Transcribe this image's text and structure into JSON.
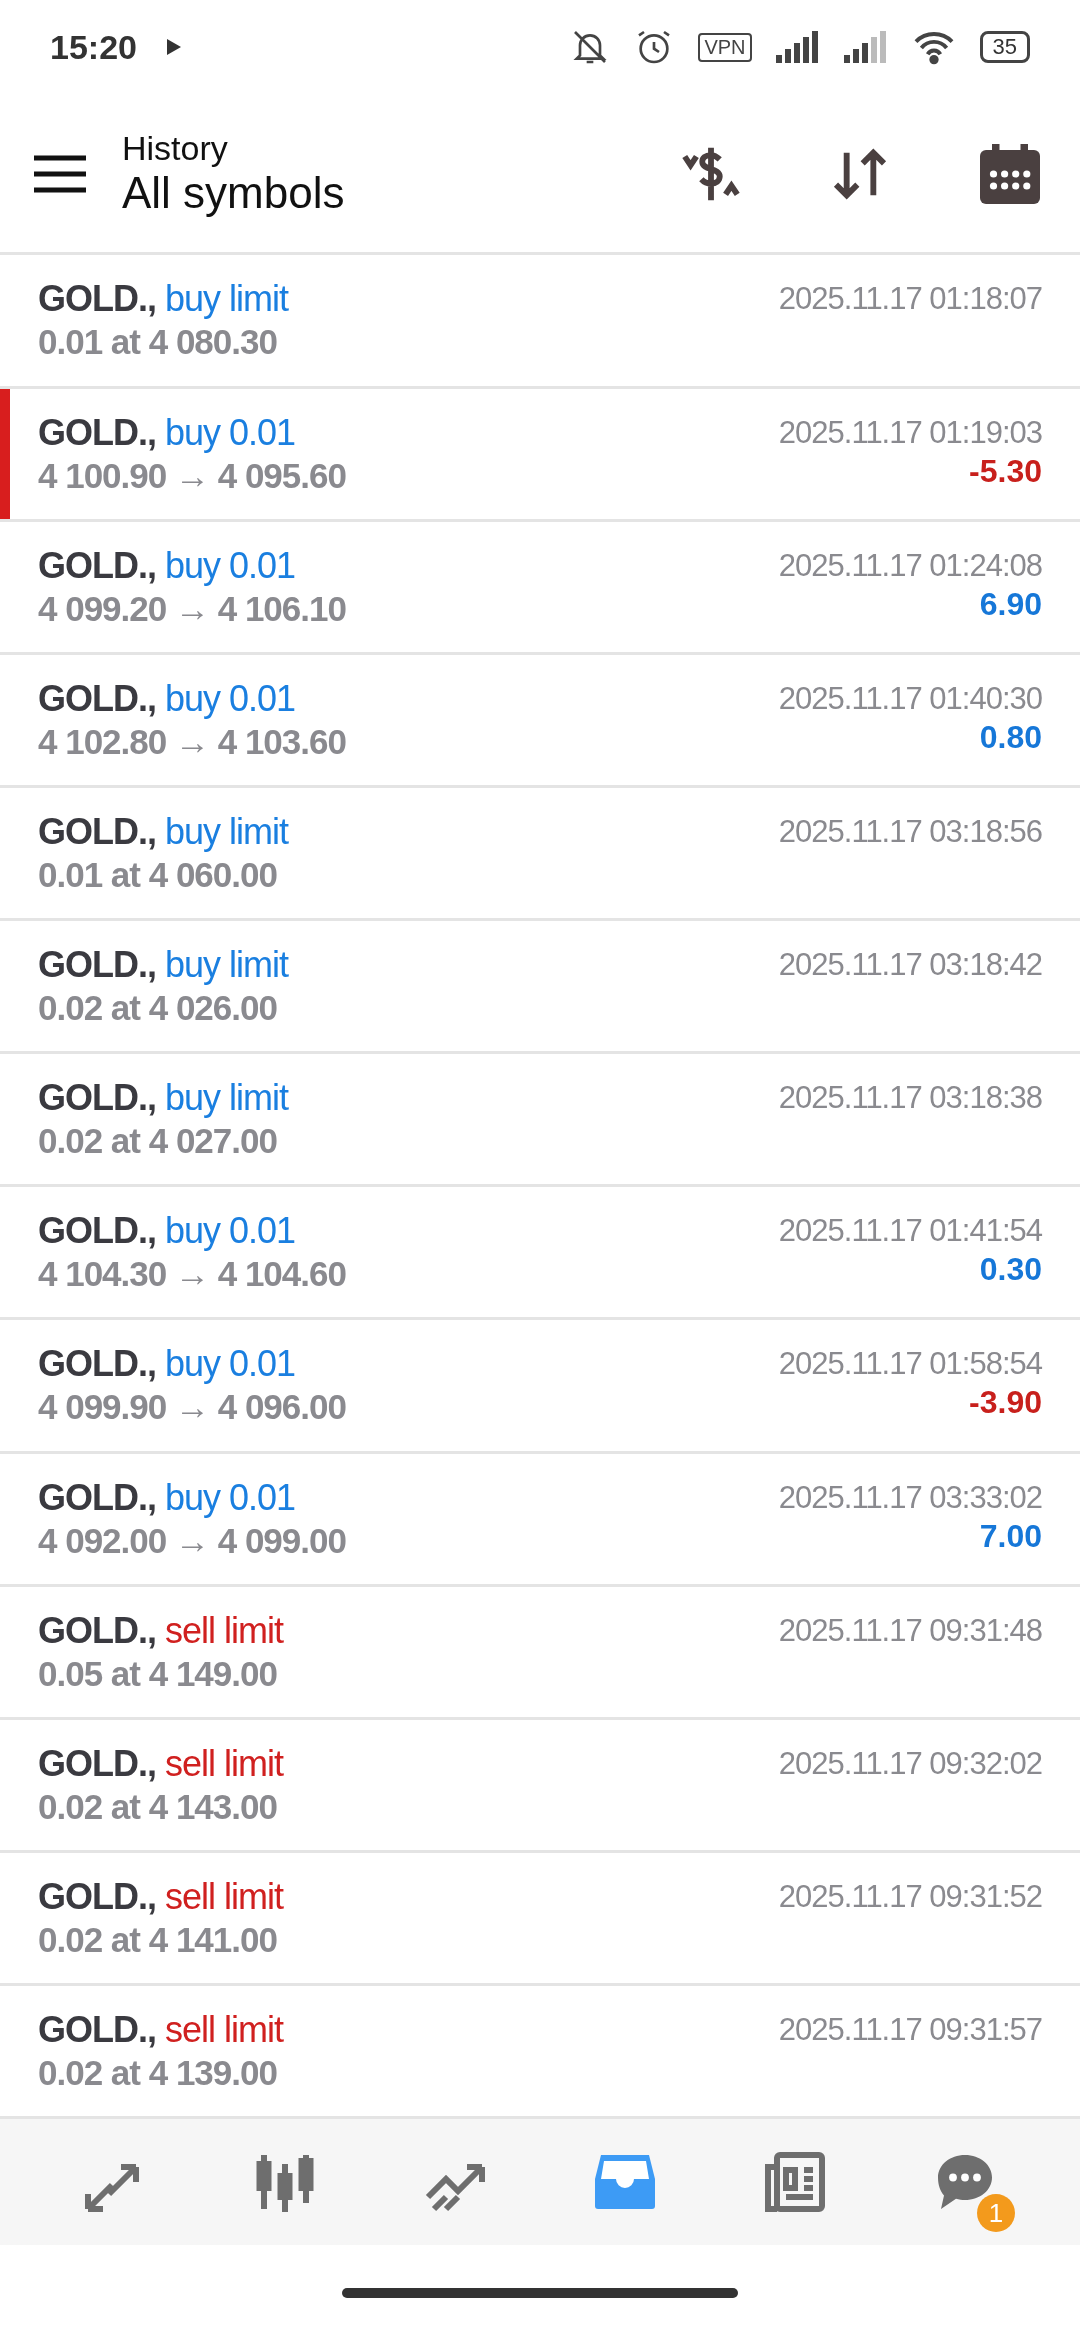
{
  "status_bar": {
    "time": "15:20",
    "vpn": "VPN",
    "battery": "35"
  },
  "header": {
    "title": "History",
    "subtitle": "All symbols"
  },
  "rows": [
    {
      "kind": "order",
      "symbol": "GOLD.,",
      "color": "#1a7fe0",
      "action": "buy limit",
      "detail": "0.01 at 4 080.30",
      "time": "2025.11.17 01:18:07",
      "marked": false
    },
    {
      "kind": "deal",
      "symbol": "GOLD.,",
      "color": "#1a7fe0",
      "action": "buy 0.01",
      "detail": "4 100.90 → 4 095.60",
      "time": "2025.11.17 01:19:03",
      "profit": "-5.30",
      "loss": true,
      "marked": true
    },
    {
      "kind": "deal",
      "symbol": "GOLD.,",
      "color": "#1a7fe0",
      "action": "buy 0.01",
      "detail": "4 099.20 → 4 106.10",
      "time": "2025.11.17 01:24:08",
      "profit": "6.90",
      "loss": false,
      "marked": false
    },
    {
      "kind": "deal",
      "symbol": "GOLD.,",
      "color": "#1a7fe0",
      "action": "buy 0.01",
      "detail": "4 102.80 → 4 103.60",
      "time": "2025.11.17 01:40:30",
      "profit": "0.80",
      "loss": false,
      "marked": false
    },
    {
      "kind": "order",
      "symbol": "GOLD.,",
      "color": "#1a7fe0",
      "action": "buy limit",
      "detail": "0.01 at 4 060.00",
      "time": "2025.11.17 03:18:56",
      "marked": false
    },
    {
      "kind": "order",
      "symbol": "GOLD.,",
      "color": "#1a7fe0",
      "action": "buy limit",
      "detail": "0.02 at 4 026.00",
      "time": "2025.11.17 03:18:42",
      "marked": false
    },
    {
      "kind": "order",
      "symbol": "GOLD.,",
      "color": "#1a7fe0",
      "action": "buy limit",
      "detail": "0.02 at 4 027.00",
      "time": "2025.11.17 03:18:38",
      "marked": false
    },
    {
      "kind": "deal",
      "symbol": "GOLD.,",
      "color": "#1a7fe0",
      "action": "buy 0.01",
      "detail": "4 104.30 → 4 104.60",
      "time": "2025.11.17 01:41:54",
      "profit": "0.30",
      "loss": false,
      "marked": false
    },
    {
      "kind": "deal",
      "symbol": "GOLD.,",
      "color": "#1a7fe0",
      "action": "buy 0.01",
      "detail": "4 099.90 → 4 096.00",
      "time": "2025.11.17 01:58:54",
      "profit": "-3.90",
      "loss": true,
      "marked": false
    },
    {
      "kind": "deal",
      "symbol": "GOLD.,",
      "color": "#1a7fe0",
      "action": "buy 0.01",
      "detail": "4 092.00 → 4 099.00",
      "time": "2025.11.17 03:33:02",
      "profit": "7.00",
      "loss": false,
      "marked": false
    },
    {
      "kind": "order",
      "symbol": "GOLD.,",
      "color": "#d0201f",
      "action": "sell limit",
      "detail": "0.05 at 4 149.00",
      "time": "2025.11.17 09:31:48",
      "marked": false
    },
    {
      "kind": "order",
      "symbol": "GOLD.,",
      "color": "#d0201f",
      "action": "sell limit",
      "detail": "0.02 at 4 143.00",
      "time": "2025.11.17 09:32:02",
      "marked": false
    },
    {
      "kind": "order",
      "symbol": "GOLD.,",
      "color": "#d0201f",
      "action": "sell limit",
      "detail": "0.02 at 4 141.00",
      "time": "2025.11.17 09:31:52",
      "marked": false
    },
    {
      "kind": "order",
      "symbol": "GOLD.,",
      "color": "#d0201f",
      "action": "sell limit",
      "detail": "0.02 at 4 139.00",
      "time": "2025.11.17 09:31:57",
      "marked": false
    }
  ],
  "nav": [
    {
      "selected": false
    },
    {
      "selected": false
    },
    {
      "selected": false
    },
    {
      "selected": true
    },
    {
      "selected": false
    },
    {
      "selected": false,
      "badge": "1"
    }
  ]
}
